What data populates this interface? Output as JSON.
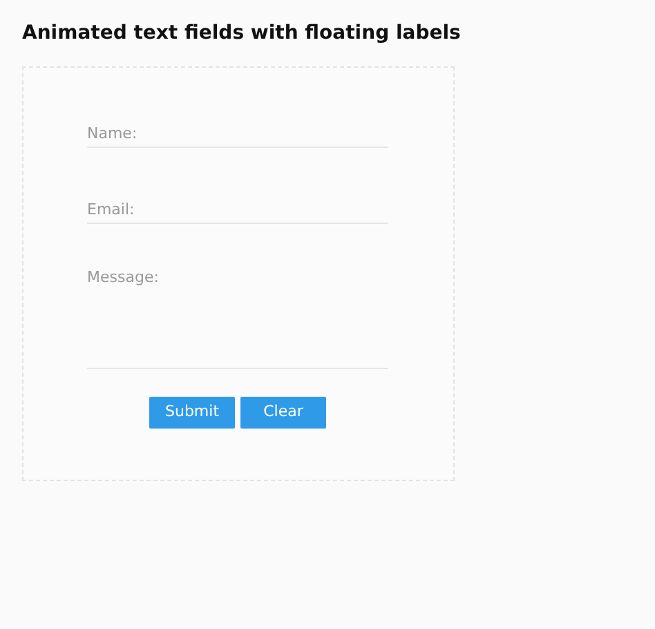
{
  "title": "Animated text fields with floating labels",
  "form": {
    "fields": [
      {
        "kind": "text",
        "placeholder": "Name:"
      },
      {
        "kind": "text",
        "placeholder": "Email:"
      },
      {
        "kind": "textarea",
        "placeholder": "Message:"
      }
    ],
    "buttons": [
      "Submit",
      "Clear"
    ]
  }
}
